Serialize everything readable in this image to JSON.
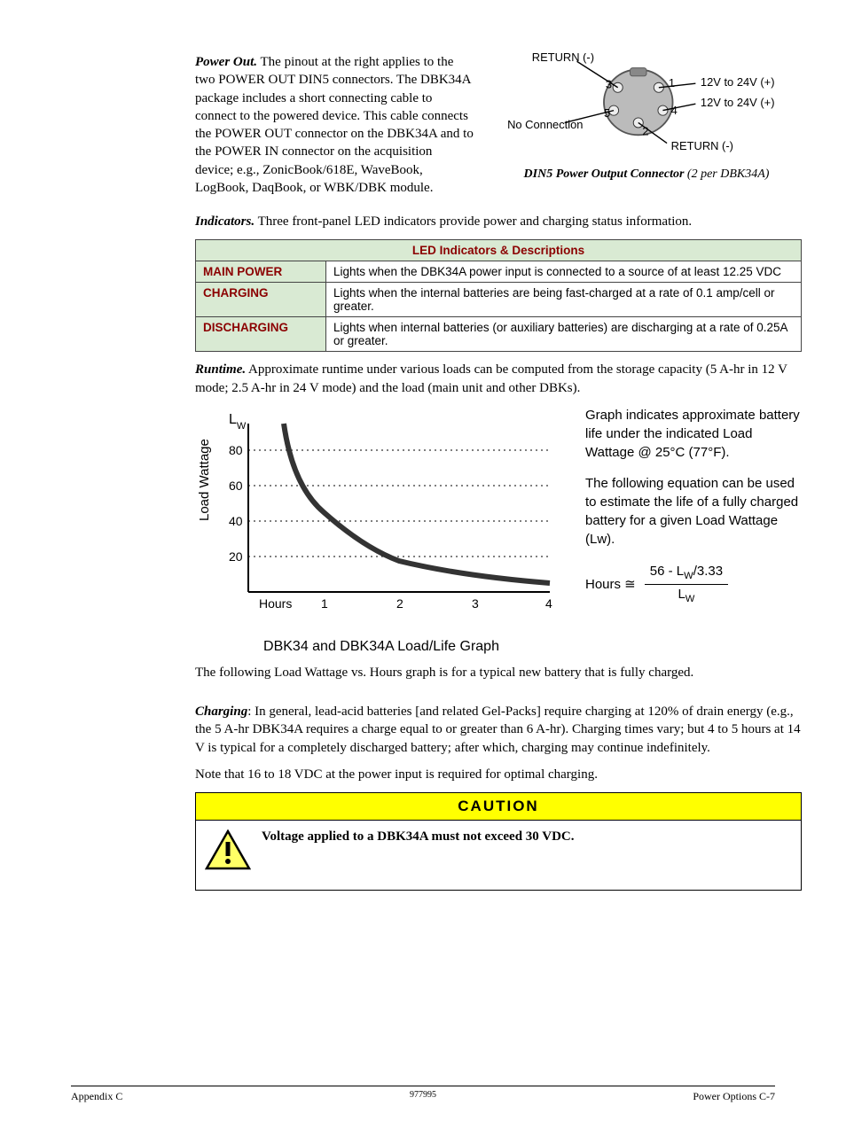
{
  "power_out": {
    "heading": "Power Out.",
    "text": "The pinout at the right applies to the two POWER OUT DIN5 connectors. The DBK34A package includes a short connecting cable to connect to the powered device. This cable connects the POWER OUT connector on the DBK34A and to the POWER IN connector on the acquisition device; e.g., ZonicBook/618E, WaveBook, LogBook, DaqBook, or WBK/DBK module.",
    "pin1": "12V to 24V (+)",
    "pin2_label": "RETURN (-)",
    "pin3_label": "RETURN (-)",
    "pin4": "12V to 24V (+)",
    "pin5": "No Connection",
    "n1": "1",
    "n2": "2",
    "n3": "3",
    "n4": "4",
    "n5": "5",
    "caption_bold": "DIN5 Power Output Connector",
    "caption_ital": " (2 per DBK34A)"
  },
  "indicators": {
    "heading": "Indicators.",
    "intro": "Three front-panel LED indicators provide power and charging status information.",
    "table_header": "LED Indicators & Descriptions",
    "rows": [
      {
        "label": "MAIN POWER",
        "desc": "Lights when the DBK34A power input  is connected to a source of at least 12.25 VDC"
      },
      {
        "label": "CHARGING",
        "desc": "Lights when the internal batteries are being fast-charged at a rate of 0.1 amp/cell or greater."
      },
      {
        "label": "DISCHARGING",
        "desc": "Lights when internal batteries (or auxiliary batteries) are discharging at a rate of 0.25A or greater."
      }
    ]
  },
  "runtime": {
    "heading": "Runtime.",
    "text": "Approximate runtime under various loads can be computed from the storage capacity (5 A-hr in 12 V mode; 2.5 A-hr in 24 V mode) and the load (main unit and other DBKs)."
  },
  "chart_data": {
    "type": "line",
    "title": "DBK34 and DBK34A Load/Life Graph",
    "xlabel": "Hours",
    "ylabel": "Load Wattage",
    "y_corner_label": "Lw",
    "xlim": [
      0,
      4
    ],
    "ylim": [
      0,
      100
    ],
    "yticks": [
      20,
      40,
      60,
      80
    ],
    "xticks": [
      1,
      2,
      3,
      4
    ],
    "series": [
      {
        "name": "Load vs Hours",
        "x": [
          0.5,
          0.75,
          1.0,
          1.5,
          2.0,
          3.0,
          4.0
        ],
        "y": [
          100,
          70,
          52,
          35,
          26,
          18,
          13
        ]
      }
    ],
    "side_text_1": "Graph indicates approximate battery life under the indicated Load Wattage @ 25°C (77°F).",
    "side_text_2": "The following equation can be used to estimate the life of a fully charged battery for a given Load Wattage (Lw).",
    "eq_lhs": "Hours ≅",
    "eq_num": "56 - Lw/3.33",
    "eq_den": "Lw"
  },
  "post_graph": "The following Load Wattage vs. Hours graph is for a typical new battery that is fully charged.",
  "charging": {
    "heading": "Charging",
    "text": ": In general, lead-acid batteries [and related Gel-Packs] require charging at 120% of drain energy (e.g., the 5 A-hr DBK34A requires a charge equal to or greater than 6 A-hr).  Charging times vary; but 4 to 5 hours at 14 V is typical for a completely discharged battery; after which, charging may continue indefinitely.",
    "note": "Note that 16 to 18 VDC at the power input is required for optimal charging."
  },
  "caution": {
    "header": "CAUTION",
    "text": "Voltage applied to a DBK34A must not exceed 30 VDC."
  },
  "footer": {
    "left": "Appendix C",
    "mid": "977995",
    "right": "Power Options    C-7"
  }
}
